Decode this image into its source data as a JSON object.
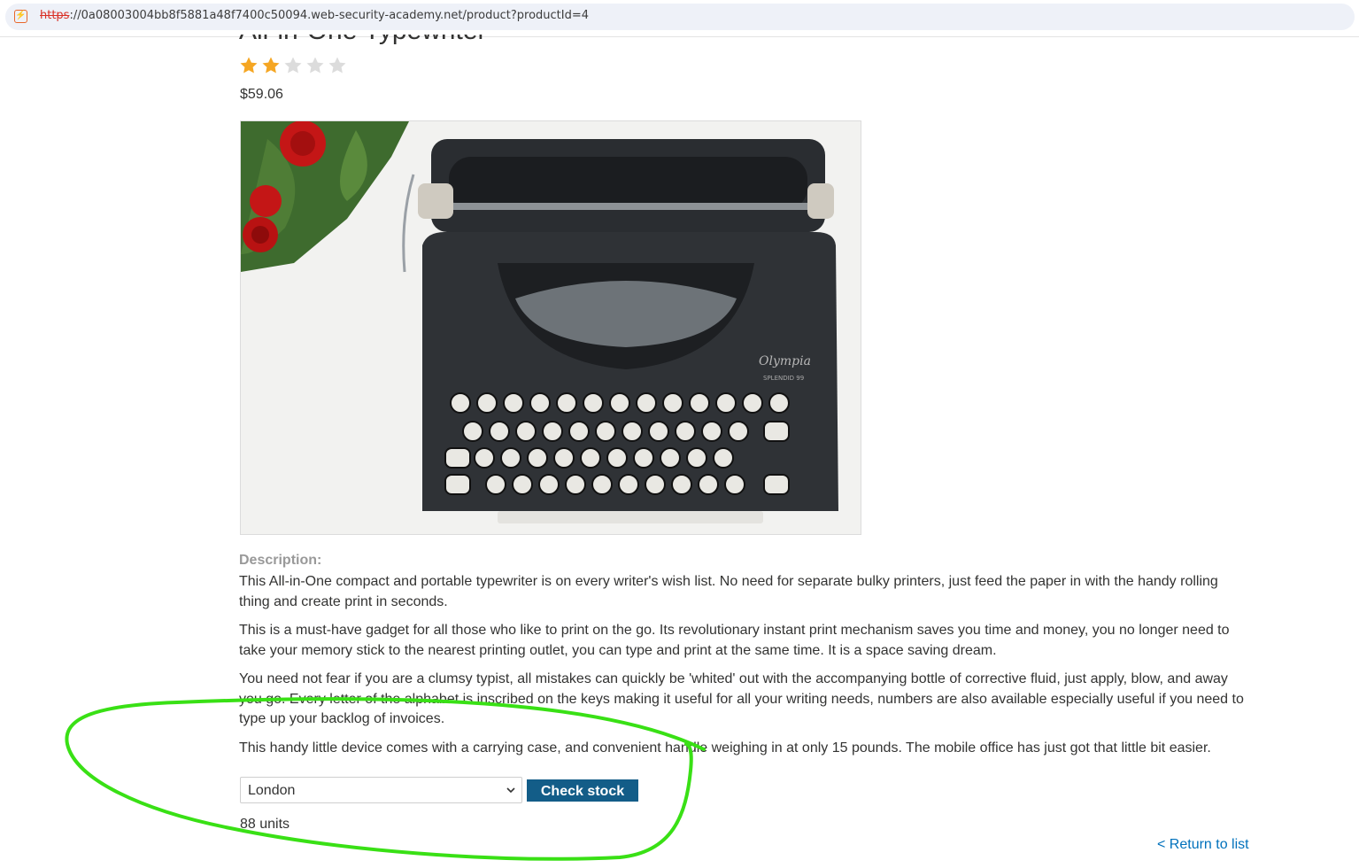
{
  "browser": {
    "url_scheme": "https",
    "url_rest": "://0a08003004bb8f5881a48f7400c50094.web-security-academy.net/product?productId=4"
  },
  "product": {
    "title": "All-in-One Typewriter",
    "rating": 2,
    "rating_max": 5,
    "price": "$59.06",
    "image_brand": "Olympia",
    "image_model": "SPLENDID 99"
  },
  "description": {
    "label": "Description:",
    "paragraphs": [
      "This All-in-One compact and portable typewriter is on every writer's wish list. No need for separate bulky printers, just feed the paper in with the handy rolling thing and create print in seconds.",
      "This is a must-have gadget for all those who like to print on the go. Its revolutionary instant print mechanism saves you time and money, you no longer need to take your memory stick to the nearest printing outlet, you can type and print at the same time. It is a space saving dream.",
      "You need not fear if you are a clumsy typist, all mistakes can quickly be 'whited' out with the accompanying bottle of corrective fluid, just apply, blow, and away you go. Every letter of the alphabet is inscribed on the keys making it useful for all your writing needs, numbers are also available especially useful if you need to type up your backlog of invoices.",
      "This handy little device comes with a carrying case, and convenient handle weighing in at only 15 pounds. The mobile office has just got that little bit easier."
    ]
  },
  "stock": {
    "selected_location": "London",
    "check_label": "Check stock",
    "result": "88 units"
  },
  "nav": {
    "return_label": "< Return to list"
  },
  "colors": {
    "star_filled": "#f5a623",
    "star_empty": "#dcdcdc",
    "button_bg": "#135d88",
    "link": "#0071bc",
    "annotation": "#39e015"
  }
}
